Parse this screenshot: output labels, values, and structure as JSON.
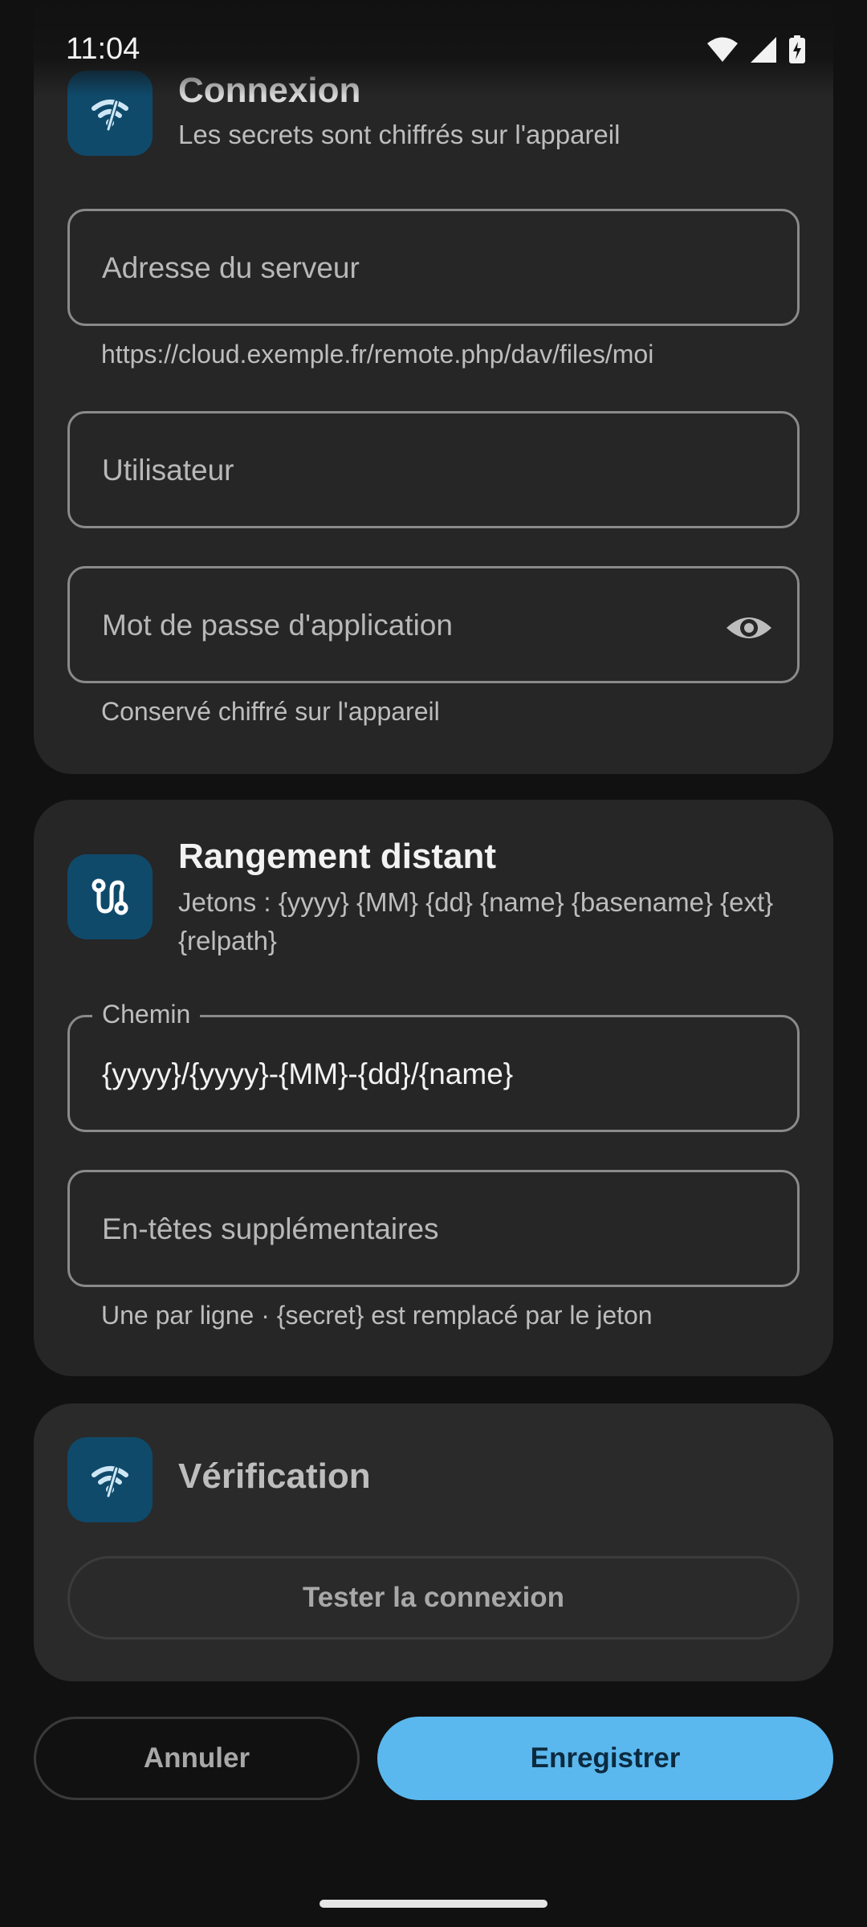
{
  "status_bar": {
    "time": "11:04",
    "icons": [
      "wifi-icon",
      "signal-icon",
      "battery-charging-icon"
    ]
  },
  "connection": {
    "title": "Connexion",
    "subtitle": "Les secrets sont chiffrés sur l'appareil",
    "icon": "wifi-off-icon",
    "server_address_placeholder": "Adresse du serveur",
    "server_address_helper": "https://cloud.exemple.fr/remote.php/dav/files/moi",
    "username_placeholder": "Utilisateur",
    "app_password_placeholder": "Mot de passe d'application",
    "app_password_helper": "Conservé chiffré sur l'appareil"
  },
  "remote_storage": {
    "title": "Rangement distant",
    "subtitle": "Jetons : {yyyy} {MM} {dd} {name} {basename} {ext} {relpath}",
    "icon": "route-icon",
    "path_label": "Chemin",
    "path_value": "{yyyy}/{yyyy}-{MM}-{dd}/{name}",
    "extra_headers_placeholder": "En-têtes supplémentaires",
    "extra_headers_helper": "Une par ligne · {secret} est remplacé par le jeton"
  },
  "verification": {
    "title": "Vérification",
    "icon": "wifi-off-icon",
    "test_button": "Tester la connexion"
  },
  "footer": {
    "cancel_label": "Annuler",
    "save_label": "Enregistrer"
  },
  "colors": {
    "accent": "#5bb8ee",
    "icon_tile": "#0f4a6b",
    "card": "#262626",
    "background": "#111111"
  }
}
